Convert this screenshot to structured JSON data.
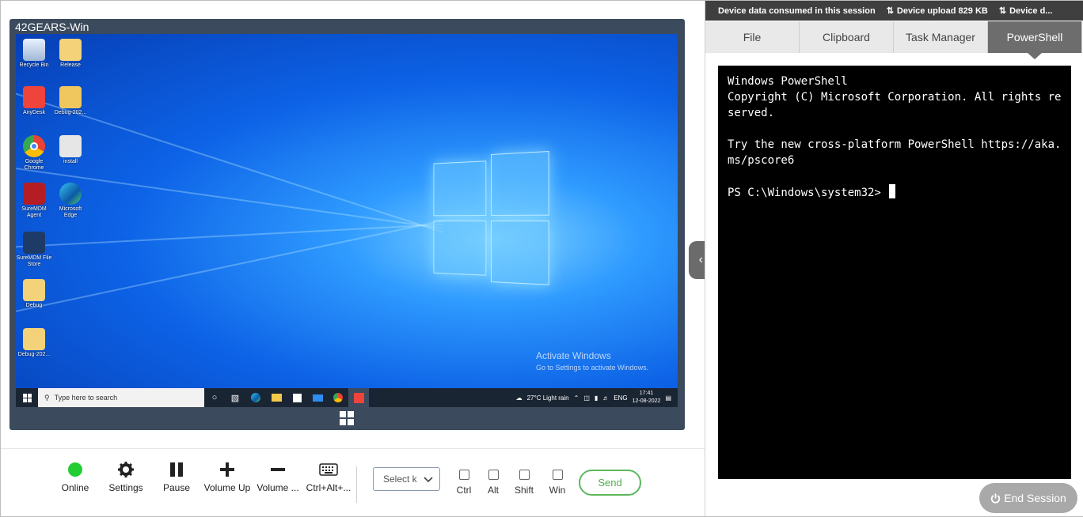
{
  "device": {
    "title": "42GEARS-Win",
    "desktop_icons": [
      {
        "label": "Recycle Bin",
        "icon": "recycle-bin-icon"
      },
      {
        "label": "Release",
        "icon": "folder-icon"
      },
      {
        "label": "AnyDesk",
        "icon": "anydesk-icon"
      },
      {
        "label": "Debug-202...",
        "icon": "zip-folder-icon"
      },
      {
        "label": "Google Chrome",
        "icon": "chrome-icon"
      },
      {
        "label": "install",
        "icon": "settings-file-icon"
      },
      {
        "label": "SureMDM Agent",
        "icon": "suremdm-agent-icon"
      },
      {
        "label": "Microsoft Edge",
        "icon": "edge-icon"
      },
      {
        "label": "SureMDM File Store",
        "icon": "file-store-icon"
      },
      {
        "label": "Debug",
        "icon": "folder-icon"
      },
      {
        "label": "Debug-202...",
        "icon": "folder-icon"
      }
    ],
    "activate_title": "Activate Windows",
    "activate_sub": "Go to Settings to activate Windows.",
    "taskbar": {
      "search_placeholder": "Type here to search",
      "weather": "27°C  Light rain",
      "lang": "ENG",
      "time": "17:41",
      "date": "12-08-2022"
    }
  },
  "toolbar": {
    "online": "Online",
    "settings": "Settings",
    "pause": "Pause",
    "volume_up": "Volume Up",
    "volume_down": "Volume ...",
    "ctrl_alt": "Ctrl+Alt+...",
    "select_key": "Select k",
    "ctrl": "Ctrl",
    "alt": "Alt",
    "shift": "Shift",
    "win": "Win",
    "send": "Send",
    "online_color": "#22cc33"
  },
  "stats": {
    "consumed": "Device data consumed in this session",
    "upload": "Device upload 829 KB",
    "download": "Device d..."
  },
  "tabs": [
    "File",
    "Clipboard",
    "Task Manager",
    "PowerShell"
  ],
  "active_tab": "PowerShell",
  "terminal": {
    "text": "Windows PowerShell\nCopyright (C) Microsoft Corporation. All rights reserved.\n\nTry the new cross-platform PowerShell https://aka.ms/pscore6\n\nPS C:\\Windows\\system32> "
  },
  "end_session": "End Session"
}
